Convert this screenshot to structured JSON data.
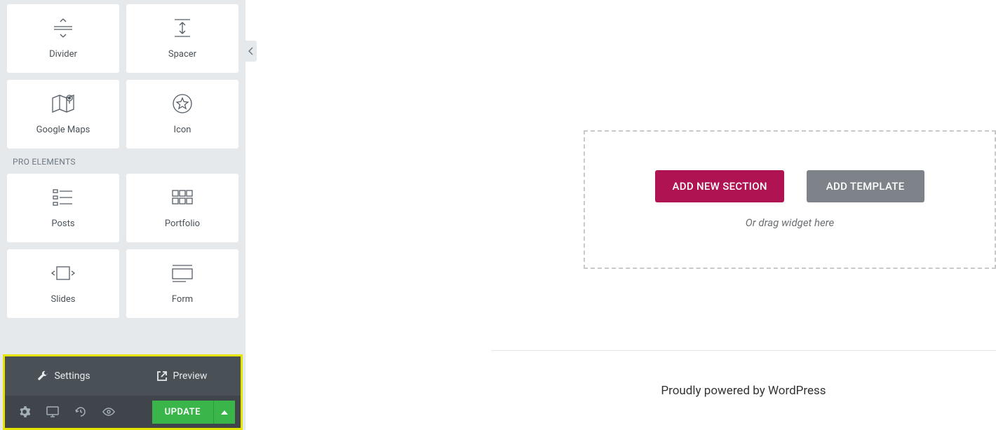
{
  "sidebar": {
    "widgets_basic": [
      {
        "label": "Divider",
        "icon": "divider"
      },
      {
        "label": "Spacer",
        "icon": "spacer"
      },
      {
        "label": "Google Maps",
        "icon": "maps"
      },
      {
        "label": "Icon",
        "icon": "star"
      }
    ],
    "section_pro": "PRO ELEMENTS",
    "widgets_pro": [
      {
        "label": "Posts",
        "icon": "posts"
      },
      {
        "label": "Portfolio",
        "icon": "portfolio"
      },
      {
        "label": "Slides",
        "icon": "slides"
      },
      {
        "label": "Form",
        "icon": "form"
      }
    ],
    "actions": {
      "settings": "Settings",
      "preview": "Preview",
      "update": "UPDATE"
    }
  },
  "canvas": {
    "add_section": "ADD NEW SECTION",
    "add_template": "ADD TEMPLATE",
    "drag_hint": "Or drag widget here",
    "footer_credit": "Proudly powered by WordPress"
  }
}
